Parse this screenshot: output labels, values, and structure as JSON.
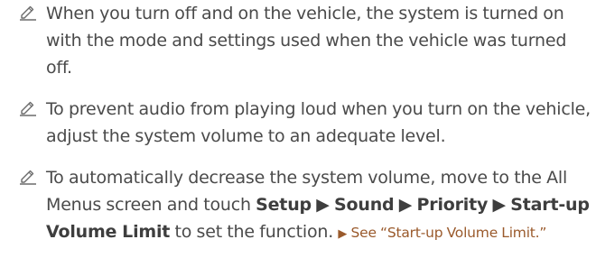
{
  "icon": "pencil-note-icon",
  "colors": {
    "text": "#4a4a4a",
    "link": "#9a5a2c",
    "icon": "#6b6b6b"
  },
  "notes": [
    {
      "text": "When you turn off and on the vehicle, the system is turned on with the mode and settings used when the vehicle was turned off."
    },
    {
      "text": "To prevent audio from playing loud when you turn on the vehicle, adjust the system volume to an adequate level."
    },
    {
      "intro": "To automatically decrease the system volume, move to the All Menus screen and touch ",
      "path": {
        "setup": "Setup",
        "sound": "Sound",
        "priority": "Priority",
        "startup_volume_limit": "Start-up Volume Limit",
        "separator": "▶"
      },
      "after_path": " to set the function. ",
      "reference": {
        "arrow": "▶",
        "label": "See “Start-up Volume Limit.”"
      }
    }
  ]
}
